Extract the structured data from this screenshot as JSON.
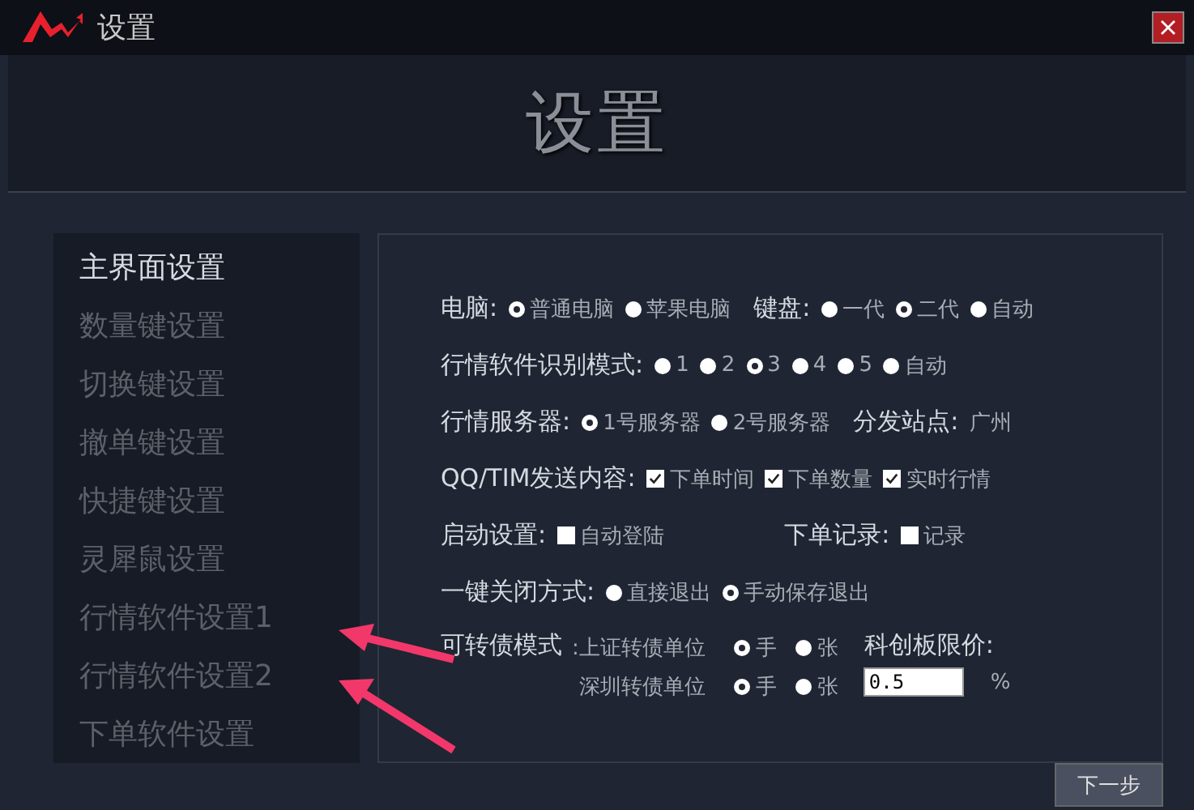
{
  "window": {
    "title": "设置"
  },
  "header": {
    "title": "设置"
  },
  "sidebar": {
    "items": [
      {
        "label": "主界面设置",
        "selected": true
      },
      {
        "label": "数量键设置",
        "selected": false
      },
      {
        "label": "切换键设置",
        "selected": false
      },
      {
        "label": "撤单键设置",
        "selected": false
      },
      {
        "label": "快捷键设置",
        "selected": false
      },
      {
        "label": "灵犀鼠设置",
        "selected": false
      },
      {
        "label": "行情软件设置1",
        "selected": false
      },
      {
        "label": "行情软件设置2",
        "selected": false
      },
      {
        "label": "下单软件设置",
        "selected": false
      }
    ]
  },
  "rows": [
    {
      "kind": "groups",
      "groups": [
        {
          "label": "电脑:",
          "items": [
            {
              "kind": "radio",
              "label": "普通电脑",
              "selected": true
            },
            {
              "kind": "radio",
              "label": "苹果电脑",
              "selected": false
            }
          ]
        },
        {
          "label": "键盘:",
          "items": [
            {
              "kind": "radio",
              "label": "一代",
              "selected": false
            },
            {
              "kind": "radio",
              "label": "二代",
              "selected": true
            },
            {
              "kind": "radio",
              "label": "自动",
              "selected": false
            }
          ]
        }
      ]
    },
    {
      "kind": "groups",
      "groups": [
        {
          "label": "行情软件识别模式:",
          "items": [
            {
              "kind": "radio",
              "label": "1",
              "selected": false
            },
            {
              "kind": "radio",
              "label": "2",
              "selected": false
            },
            {
              "kind": "radio",
              "label": "3",
              "selected": true
            },
            {
              "kind": "radio",
              "label": "4",
              "selected": false
            },
            {
              "kind": "radio",
              "label": "5",
              "selected": false
            },
            {
              "kind": "radio",
              "label": "自动",
              "selected": false
            }
          ]
        }
      ]
    },
    {
      "kind": "groups",
      "groups": [
        {
          "label": "行情服务器:",
          "items": [
            {
              "kind": "radio",
              "label": "1号服务器",
              "selected": true
            },
            {
              "kind": "radio",
              "label": "2号服务器",
              "selected": false
            }
          ]
        },
        {
          "label": "分发站点:",
          "items": [
            {
              "kind": "text",
              "label": "广州"
            }
          ]
        }
      ]
    },
    {
      "kind": "groups",
      "groups": [
        {
          "label": "QQ/TIM发送内容:",
          "items": [
            {
              "kind": "checkbox",
              "label": "下单时间",
              "checked": true
            },
            {
              "kind": "checkbox",
              "label": "下单数量",
              "checked": true
            },
            {
              "kind": "checkbox",
              "label": "实时行情",
              "checked": true
            }
          ]
        }
      ]
    },
    {
      "kind": "spread",
      "groups": [
        {
          "label": "启动设置:",
          "items": [
            {
              "kind": "checkbox",
              "label": "自动登陆",
              "checked": false
            }
          ]
        },
        {
          "label": "下单记录:",
          "items": [
            {
              "kind": "checkbox",
              "label": "记录",
              "checked": false
            }
          ]
        }
      ]
    },
    {
      "kind": "groups",
      "groups": [
        {
          "label": "一键关闭方式:",
          "items": [
            {
              "kind": "radio",
              "label": "直接退出",
              "selected": false
            },
            {
              "kind": "radio",
              "label": "手动保存退出",
              "selected": true
            }
          ]
        }
      ]
    },
    {
      "kind": "bond",
      "label": "可转债模式",
      "lines": [
        {
          "label": ":上证转债单位",
          "items": [
            {
              "kind": "radio",
              "label": "手",
              "selected": true
            },
            {
              "kind": "radio",
              "label": "张",
              "selected": false
            }
          ]
        },
        {
          "label": "深圳转债单位",
          "items": [
            {
              "kind": "radio",
              "label": "手",
              "selected": true
            },
            {
              "kind": "radio",
              "label": "张",
              "selected": false
            }
          ]
        }
      ],
      "limit": {
        "label": "科创板限价:",
        "value": "0.5",
        "unit": "%"
      }
    }
  ],
  "next_button": {
    "label": "下一步"
  }
}
